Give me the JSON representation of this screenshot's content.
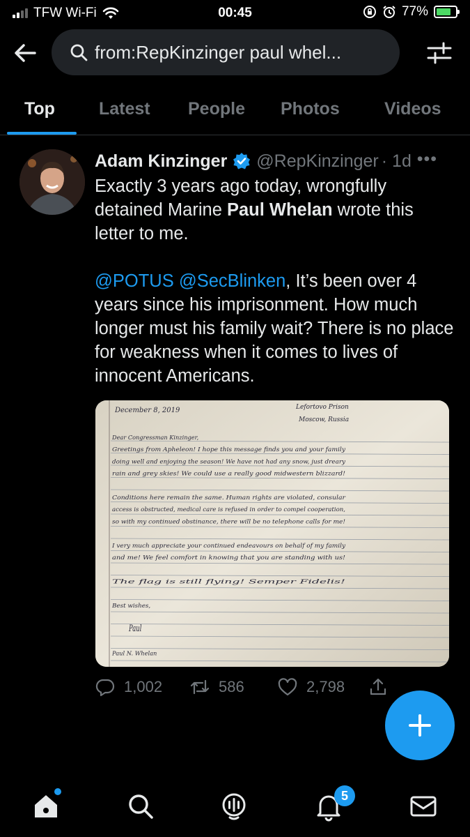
{
  "status_bar": {
    "carrier": "TFW Wi-Fi",
    "time": "00:45",
    "battery": "77%",
    "battery_level": 0.77
  },
  "search": {
    "query": "from:RepKinzinger paul whel..."
  },
  "tabs": [
    {
      "label": "Top",
      "active": true
    },
    {
      "label": "Latest",
      "active": false
    },
    {
      "label": "People",
      "active": false
    },
    {
      "label": "Photos",
      "active": false
    },
    {
      "label": "Videos",
      "active": false
    }
  ],
  "tweet": {
    "name": "Adam Kinzinger",
    "handle": "@RepKinzinger",
    "time": "· 1d",
    "more": "•••",
    "para1_a": "Exactly 3 years ago today, wrongfully detained Marine ",
    "para1_bold": "Paul Whelan",
    "para1_b": " wrote this letter to me.",
    "mention1": "@POTUS",
    "mention2": "@SecBlinken",
    "para2": ", It’s been over 4 years since his imprisonment. How much longer must his family wait? There is no place for weakness when it comes to lives of innocent Americans.",
    "replies": "1,002",
    "retweets": "586",
    "likes": "2,798"
  },
  "letter": {
    "date": "December 8, 2019",
    "address1": "Lefortovo Prison",
    "address2": "Moscow, Russia",
    "lines": [
      "Dear Congressman Kinzinger,",
      "Greetings from Apheleon! I hope this message finds you and your family",
      "doing well and enjoying the season! We have not had any snow, just dreary",
      "rain and grey skies! We could use a really good midwestern blizzard!",
      "",
      "Conditions here remain the same. Human rights are violated, consular",
      "access is obstructed, medical care is refused in order to compel cooperation,",
      "so with my continued obstinance, there will be no telephone calls for me!",
      "",
      "I very much appreciate your continued endeavours on behalf of my family",
      "and me! We feel comfort in knowing that you are standing with us!",
      "",
      "The flag is still flying!   Semper Fidelis!",
      "",
      "Best wishes,",
      "",
      "Paul",
      "",
      "Paul N. Whelan"
    ]
  },
  "nav": {
    "notifications_badge": "5"
  },
  "colors": {
    "accent": "#1d9bf0",
    "background": "#000000",
    "muted": "#71767b"
  }
}
